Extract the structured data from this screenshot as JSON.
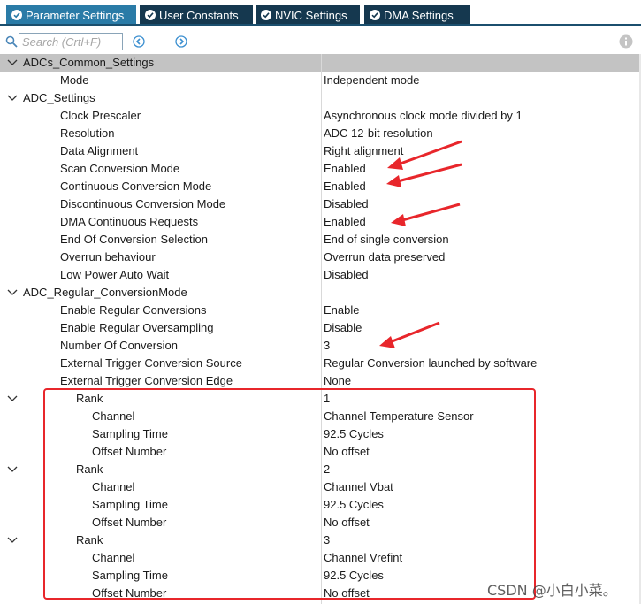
{
  "tabs": [
    {
      "label": "Parameter Settings",
      "active": true
    },
    {
      "label": "User Constants",
      "active": false
    },
    {
      "label": "NVIC Settings",
      "active": false
    },
    {
      "label": "DMA Settings",
      "active": false
    }
  ],
  "toolbar": {
    "search_placeholder": "Search (Crtl+F)",
    "search_icon": "search-icon",
    "prev_icon": "arrow-left-circle-icon",
    "next_icon": "arrow-right-circle-icon",
    "info_icon": "info-icon"
  },
  "tree": {
    "group_common": {
      "title": "ADCs_Common_Settings",
      "params": [
        {
          "name": "Mode",
          "value": "Independent mode"
        }
      ]
    },
    "group_adc": {
      "title": "ADC_Settings",
      "params": [
        {
          "name": "Clock Prescaler",
          "value": "Asynchronous clock mode divided by 1"
        },
        {
          "name": "Resolution",
          "value": "ADC 12-bit resolution"
        },
        {
          "name": "Data Alignment",
          "value": "Right alignment"
        },
        {
          "name": "Scan Conversion Mode",
          "value": "Enabled"
        },
        {
          "name": "Continuous Conversion Mode",
          "value": "Enabled"
        },
        {
          "name": "Discontinuous Conversion Mode",
          "value": "Disabled"
        },
        {
          "name": "DMA Continuous Requests",
          "value": "Enabled"
        },
        {
          "name": "End Of Conversion Selection",
          "value": "End of single conversion"
        },
        {
          "name": "Overrun behaviour",
          "value": "Overrun data preserved"
        },
        {
          "name": "Low Power Auto Wait",
          "value": "Disabled"
        }
      ]
    },
    "group_regular": {
      "title": "ADC_Regular_ConversionMode",
      "params": [
        {
          "name": "Enable Regular Conversions",
          "value": "Enable"
        },
        {
          "name": "Enable Regular Oversampling",
          "value": "Disable"
        },
        {
          "name": "Number Of Conversion",
          "value": "3"
        },
        {
          "name": "External Trigger Conversion Source",
          "value": "Regular Conversion launched by software"
        },
        {
          "name": "External Trigger Conversion Edge",
          "value": "None"
        }
      ],
      "ranks": [
        {
          "label": "Rank",
          "value": "1",
          "params": [
            {
              "name": "Channel",
              "value": "Channel Temperature Sensor"
            },
            {
              "name": "Sampling Time",
              "value": "92.5 Cycles"
            },
            {
              "name": "Offset Number",
              "value": "No offset"
            }
          ]
        },
        {
          "label": "Rank",
          "value": "2",
          "params": [
            {
              "name": "Channel",
              "value": "Channel Vbat"
            },
            {
              "name": "Sampling Time",
              "value": "92.5 Cycles"
            },
            {
              "name": "Offset Number",
              "value": "No offset"
            }
          ]
        },
        {
          "label": "Rank",
          "value": "3",
          "params": [
            {
              "name": "Channel",
              "value": "Channel Vrefint"
            },
            {
              "name": "Sampling Time",
              "value": "92.5 Cycles"
            },
            {
              "name": "Offset Number",
              "value": "No offset"
            }
          ]
        }
      ]
    }
  },
  "annotations": {
    "arrow_color": "#e8262b",
    "box_color": "#e8262b"
  },
  "watermark": "CSDN @小白小菜。",
  "colors": {
    "active_tab": "#2a7ba7",
    "inactive_tab": "#15384f",
    "group_header_bg": "#c3c3c3"
  }
}
